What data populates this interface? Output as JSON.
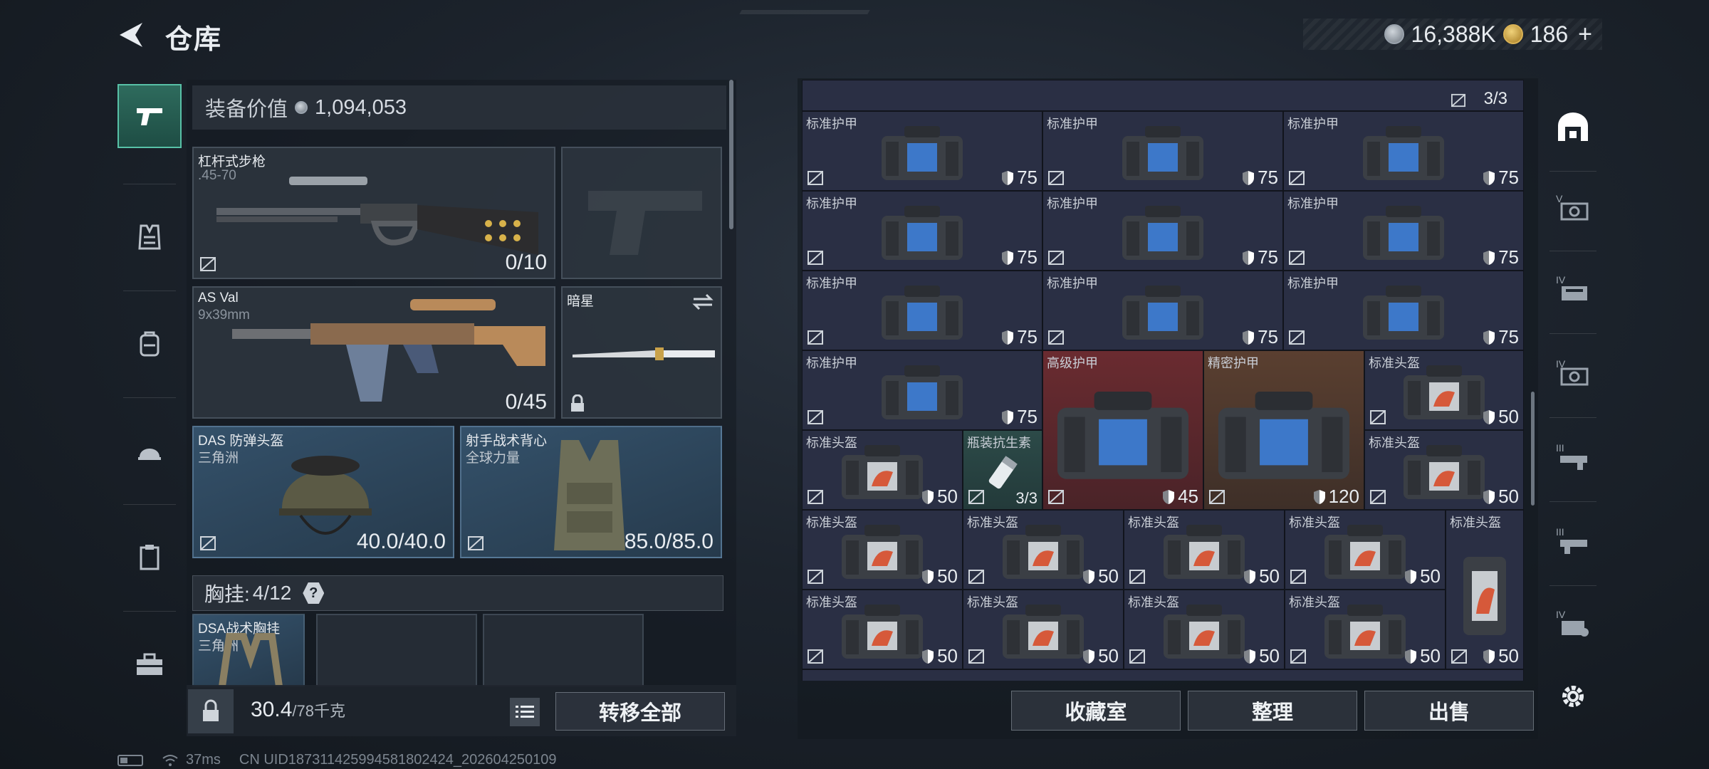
{
  "header": {
    "title": "仓库",
    "silver_amount": "16,388K",
    "gold_amount": "186",
    "add_label": "+"
  },
  "left_panel": {
    "equip_value_label": "装备价值",
    "equip_value": "1,094,053",
    "primary_weapon": {
      "name": "杠杆式步枪",
      "caliber": ".45-70",
      "ammo": "0/10"
    },
    "secondary_weapon": {
      "name": "AS Val",
      "caliber": "9x39mm",
      "ammo": "0/45"
    },
    "melee": {
      "name": "暗星"
    },
    "helmet": {
      "name": "DAS 防弹头盔",
      "faction": "三角洲",
      "durability": "40.0/40.0"
    },
    "armor": {
      "name": "射手战术背心",
      "faction": "全球力量",
      "durability": "85.0/85.0"
    },
    "chest_rig": {
      "label": "胸挂:",
      "capacity": "4/12",
      "help": "?",
      "item_name": "DSA战术胸挂",
      "item_faction": "三角洲"
    },
    "weight": {
      "current": "30.4",
      "max": "/78千克"
    },
    "transfer_all_label": "转移全部"
  },
  "stash": {
    "top_count": "3/3",
    "rows": [
      [
        {
          "name": "标准护甲",
          "val": "75",
          "type": "armor"
        },
        {
          "name": "标准护甲",
          "val": "75",
          "type": "armor"
        },
        {
          "name": "标准护甲",
          "val": "75",
          "type": "armor"
        }
      ],
      [
        {
          "name": "标准护甲",
          "val": "75",
          "type": "armor"
        },
        {
          "name": "标准护甲",
          "val": "75",
          "type": "armor"
        },
        {
          "name": "标准护甲",
          "val": "75",
          "type": "armor"
        }
      ],
      [
        {
          "name": "标准护甲",
          "val": "75",
          "type": "armor"
        },
        {
          "name": "标准护甲",
          "val": "75",
          "type": "armor"
        },
        {
          "name": "标准护甲",
          "val": "75",
          "type": "armor"
        }
      ]
    ],
    "row4": {
      "a": {
        "name": "标准护甲",
        "val": "75"
      },
      "advanced": {
        "name": "高级护甲",
        "val": "45"
      },
      "precision": {
        "name": "精密护甲",
        "val": "120"
      },
      "helmet": {
        "name": "标准头盔",
        "val": "50"
      }
    },
    "row5": {
      "helmet": {
        "name": "标准头盔",
        "val": "50"
      },
      "antibiotic": {
        "name": "瓶装抗生素",
        "val": "3/3"
      },
      "helmet2": {
        "name": "标准头盔",
        "val": "50"
      }
    },
    "row6": [
      {
        "name": "标准头盔",
        "val": "50"
      },
      {
        "name": "标准头盔",
        "val": "50"
      },
      {
        "name": "标准头盔",
        "val": "50"
      },
      {
        "name": "标准头盔",
        "val": "50"
      }
    ],
    "row7": [
      {
        "name": "标准头盔",
        "val": "50"
      },
      {
        "name": "标准头盔",
        "val": "50"
      },
      {
        "name": "标准头盔",
        "val": "50"
      },
      {
        "name": "标准头盔",
        "val": "50"
      }
    ],
    "tall_helmet": {
      "name": "标准头盔",
      "val": "50"
    },
    "buttons": {
      "collection": "收藏室",
      "organize": "整理",
      "sell": "出售"
    }
  },
  "status": {
    "ping": "37ms",
    "uid": "CN UID18731142599458180242​4_202604250109"
  },
  "colors": {
    "accent_teal": "#58c1a7",
    "advanced_bg": "#6a2b30",
    "precision_bg": "#5a3f30"
  }
}
